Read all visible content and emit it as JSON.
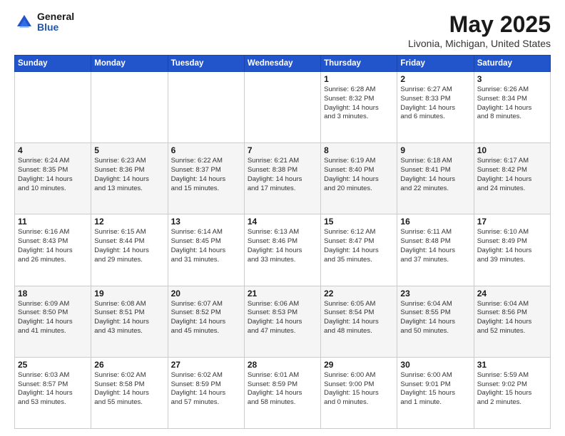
{
  "logo": {
    "general": "General",
    "blue": "Blue"
  },
  "title": {
    "month": "May 2025",
    "location": "Livonia, Michigan, United States"
  },
  "days_header": [
    "Sunday",
    "Monday",
    "Tuesday",
    "Wednesday",
    "Thursday",
    "Friday",
    "Saturday"
  ],
  "weeks": [
    [
      {
        "day": "",
        "info": ""
      },
      {
        "day": "",
        "info": ""
      },
      {
        "day": "",
        "info": ""
      },
      {
        "day": "",
        "info": ""
      },
      {
        "day": "1",
        "info": "Sunrise: 6:28 AM\nSunset: 8:32 PM\nDaylight: 14 hours\nand 3 minutes."
      },
      {
        "day": "2",
        "info": "Sunrise: 6:27 AM\nSunset: 8:33 PM\nDaylight: 14 hours\nand 6 minutes."
      },
      {
        "day": "3",
        "info": "Sunrise: 6:26 AM\nSunset: 8:34 PM\nDaylight: 14 hours\nand 8 minutes."
      }
    ],
    [
      {
        "day": "4",
        "info": "Sunrise: 6:24 AM\nSunset: 8:35 PM\nDaylight: 14 hours\nand 10 minutes."
      },
      {
        "day": "5",
        "info": "Sunrise: 6:23 AM\nSunset: 8:36 PM\nDaylight: 14 hours\nand 13 minutes."
      },
      {
        "day": "6",
        "info": "Sunrise: 6:22 AM\nSunset: 8:37 PM\nDaylight: 14 hours\nand 15 minutes."
      },
      {
        "day": "7",
        "info": "Sunrise: 6:21 AM\nSunset: 8:38 PM\nDaylight: 14 hours\nand 17 minutes."
      },
      {
        "day": "8",
        "info": "Sunrise: 6:19 AM\nSunset: 8:40 PM\nDaylight: 14 hours\nand 20 minutes."
      },
      {
        "day": "9",
        "info": "Sunrise: 6:18 AM\nSunset: 8:41 PM\nDaylight: 14 hours\nand 22 minutes."
      },
      {
        "day": "10",
        "info": "Sunrise: 6:17 AM\nSunset: 8:42 PM\nDaylight: 14 hours\nand 24 minutes."
      }
    ],
    [
      {
        "day": "11",
        "info": "Sunrise: 6:16 AM\nSunset: 8:43 PM\nDaylight: 14 hours\nand 26 minutes."
      },
      {
        "day": "12",
        "info": "Sunrise: 6:15 AM\nSunset: 8:44 PM\nDaylight: 14 hours\nand 29 minutes."
      },
      {
        "day": "13",
        "info": "Sunrise: 6:14 AM\nSunset: 8:45 PM\nDaylight: 14 hours\nand 31 minutes."
      },
      {
        "day": "14",
        "info": "Sunrise: 6:13 AM\nSunset: 8:46 PM\nDaylight: 14 hours\nand 33 minutes."
      },
      {
        "day": "15",
        "info": "Sunrise: 6:12 AM\nSunset: 8:47 PM\nDaylight: 14 hours\nand 35 minutes."
      },
      {
        "day": "16",
        "info": "Sunrise: 6:11 AM\nSunset: 8:48 PM\nDaylight: 14 hours\nand 37 minutes."
      },
      {
        "day": "17",
        "info": "Sunrise: 6:10 AM\nSunset: 8:49 PM\nDaylight: 14 hours\nand 39 minutes."
      }
    ],
    [
      {
        "day": "18",
        "info": "Sunrise: 6:09 AM\nSunset: 8:50 PM\nDaylight: 14 hours\nand 41 minutes."
      },
      {
        "day": "19",
        "info": "Sunrise: 6:08 AM\nSunset: 8:51 PM\nDaylight: 14 hours\nand 43 minutes."
      },
      {
        "day": "20",
        "info": "Sunrise: 6:07 AM\nSunset: 8:52 PM\nDaylight: 14 hours\nand 45 minutes."
      },
      {
        "day": "21",
        "info": "Sunrise: 6:06 AM\nSunset: 8:53 PM\nDaylight: 14 hours\nand 47 minutes."
      },
      {
        "day": "22",
        "info": "Sunrise: 6:05 AM\nSunset: 8:54 PM\nDaylight: 14 hours\nand 48 minutes."
      },
      {
        "day": "23",
        "info": "Sunrise: 6:04 AM\nSunset: 8:55 PM\nDaylight: 14 hours\nand 50 minutes."
      },
      {
        "day": "24",
        "info": "Sunrise: 6:04 AM\nSunset: 8:56 PM\nDaylight: 14 hours\nand 52 minutes."
      }
    ],
    [
      {
        "day": "25",
        "info": "Sunrise: 6:03 AM\nSunset: 8:57 PM\nDaylight: 14 hours\nand 53 minutes."
      },
      {
        "day": "26",
        "info": "Sunrise: 6:02 AM\nSunset: 8:58 PM\nDaylight: 14 hours\nand 55 minutes."
      },
      {
        "day": "27",
        "info": "Sunrise: 6:02 AM\nSunset: 8:59 PM\nDaylight: 14 hours\nand 57 minutes."
      },
      {
        "day": "28",
        "info": "Sunrise: 6:01 AM\nSunset: 8:59 PM\nDaylight: 14 hours\nand 58 minutes."
      },
      {
        "day": "29",
        "info": "Sunrise: 6:00 AM\nSunset: 9:00 PM\nDaylight: 15 hours\nand 0 minutes."
      },
      {
        "day": "30",
        "info": "Sunrise: 6:00 AM\nSunset: 9:01 PM\nDaylight: 15 hours\nand 1 minute."
      },
      {
        "day": "31",
        "info": "Sunrise: 5:59 AM\nSunset: 9:02 PM\nDaylight: 15 hours\nand 2 minutes."
      }
    ]
  ]
}
